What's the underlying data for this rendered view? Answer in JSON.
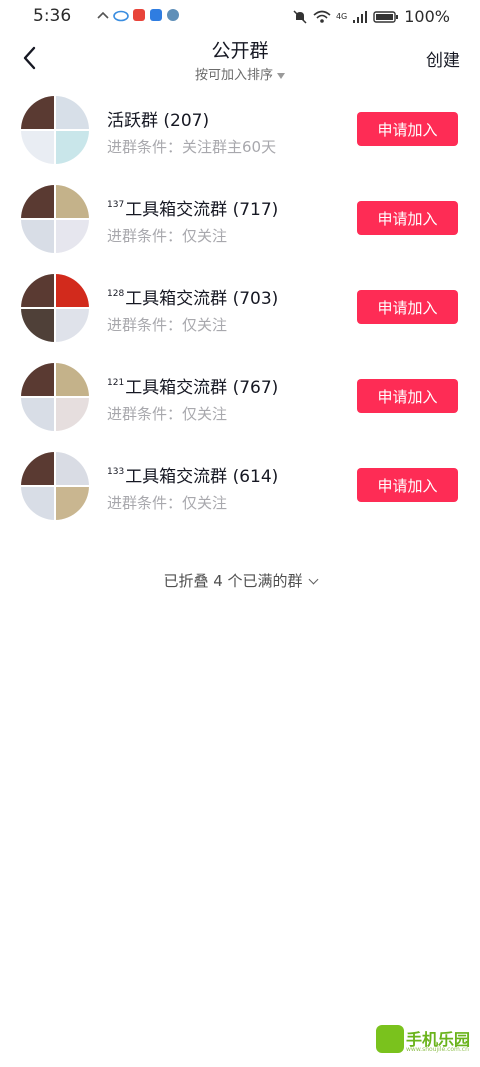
{
  "status_bar": {
    "time": "5:36",
    "battery": "100%",
    "network": "4G"
  },
  "nav": {
    "title": "公开群",
    "sort_label": "按可加入排序",
    "create_label": "创建"
  },
  "groups": [
    {
      "prefix": "",
      "name": "活跃群 (207)",
      "condition": "进群条件：关注群主60天",
      "join_label": "申请加入",
      "avatar_colors": [
        "#5a3a32",
        "#d7dfe8",
        "#e9edf3",
        "#c9e6ea"
      ]
    },
    {
      "prefix": "137",
      "name": "工具箱交流群 (717)",
      "condition": "进群条件：仅关注",
      "join_label": "申请加入",
      "avatar_colors": [
        "#5a3a32",
        "#c4b28a",
        "#d8dde6",
        "#e6e6ee"
      ]
    },
    {
      "prefix": "128",
      "name": "工具箱交流群 (703)",
      "condition": "进群条件：仅关注",
      "join_label": "申请加入",
      "avatar_colors": [
        "#5a3a32",
        "#d22a1c",
        "#4f4038",
        "#dfe2ea"
      ]
    },
    {
      "prefix": "121",
      "name": "工具箱交流群 (767)",
      "condition": "进群条件：仅关注",
      "join_label": "申请加入",
      "avatar_colors": [
        "#5a3a32",
        "#c4b28a",
        "#d8dde6",
        "#e6dede"
      ]
    },
    {
      "prefix": "133",
      "name": "工具箱交流群 (614)",
      "condition": "进群条件：仅关注",
      "join_label": "申请加入",
      "avatar_colors": [
        "#5a3a32",
        "#d9dce4",
        "#d8dde6",
        "#c9b690"
      ]
    }
  ],
  "folded_label": "已折叠 4 个已满的群",
  "watermark": {
    "text": "手机乐园",
    "sub": "www.shoujile.com.cn"
  },
  "colors": {
    "accent": "#fe2c55",
    "primary_text": "#161823",
    "secondary_text": "#a8a8ad"
  }
}
